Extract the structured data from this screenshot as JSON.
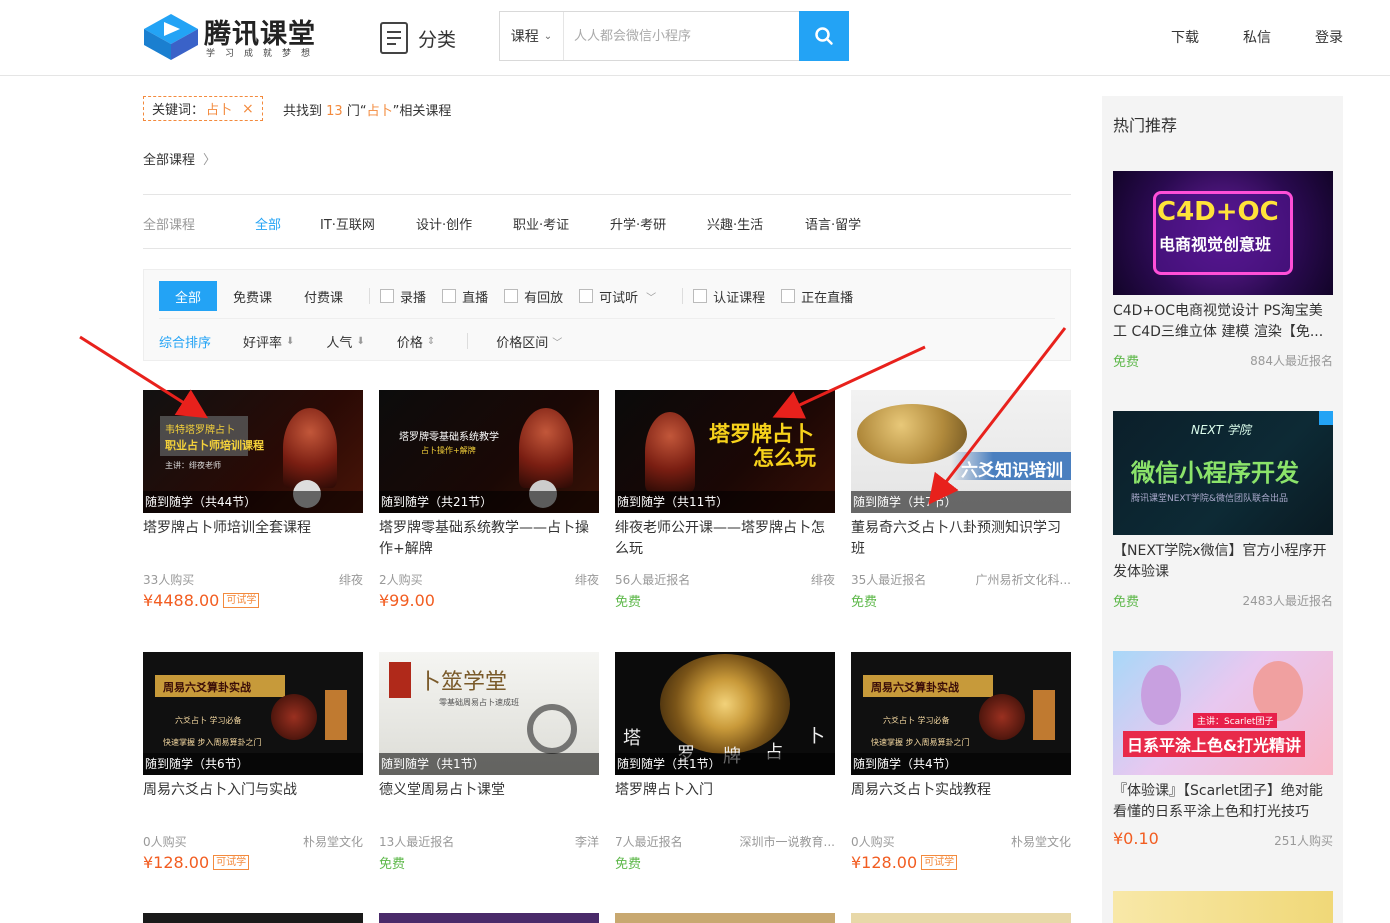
{
  "header": {
    "logo_title": "腾讯课堂",
    "logo_subtitle": "学习成就梦想",
    "category_label": "分类",
    "search_type": "课程",
    "search_placeholder": "人人都会微信小程序",
    "nav": [
      "下载",
      "私信",
      "登录"
    ]
  },
  "keyword_filter": {
    "label": "关键词：",
    "value": "占卜",
    "remove_icon": "close-icon"
  },
  "result_summary": {
    "prefix": "共找到",
    "count": "13",
    "middle": "门“",
    "keyword": "占卜",
    "suffix": "”相关课程"
  },
  "breadcrumb": "全部课程",
  "category_tabs": {
    "lead": "全部课程",
    "items": [
      "全部",
      "IT·互联网",
      "设计·创作",
      "职业·考证",
      "升学·考研",
      "兴趣·生活",
      "语言·留学"
    ],
    "active_index": 0
  },
  "filters": {
    "type_pills": [
      "全部",
      "免费课",
      "付费课"
    ],
    "checkboxes": [
      "录播",
      "直播",
      "有回放",
      "可试听",
      "认证课程",
      "正在直播"
    ],
    "sorts": [
      "综合排序",
      "好评率",
      "人气",
      "价格",
      "价格区间"
    ]
  },
  "courses": [
    {
      "badge": "随到随学（共44节）",
      "title": "塔罗牌占卜师培训全套课程",
      "buyers": "33人购买",
      "author": "绯夜",
      "price": "¥4488.00",
      "trial": "可试学",
      "thumb_text": [
        "韦特塔罗牌占卜",
        "职业占卜师培训课程",
        "主讲：绯夜老师"
      ]
    },
    {
      "badge": "随到随学（共21节）",
      "title": "塔罗牌零基础系统教学——占卜操作+解牌",
      "buyers": "2人购买",
      "author": "绯夜",
      "price": "¥99.00",
      "trial": "",
      "thumb_text": [
        "塔罗牌零基础系统教学",
        "占卜操作+解牌"
      ]
    },
    {
      "badge": "随到随学（共11节）",
      "title": "绯夜老师公开课——塔罗牌占卜怎么玩",
      "buyers": "56人最近报名",
      "author": "绯夜",
      "price": "免费",
      "trial": "",
      "thumb_text": [
        "塔罗牌占卜",
        "怎么玩"
      ]
    },
    {
      "badge": "随到随学（共7节）",
      "title": "董易奇六爻占卜八卦预测知识学习班",
      "buyers": "35人最近报名",
      "author": "广州易祈文化科...",
      "price": "免费",
      "trial": "",
      "thumb_text": [
        "六爻知识培训"
      ]
    },
    {
      "badge": "随到随学（共6节）",
      "title": "周易六爻占卜入门与实战",
      "buyers": "0人购买",
      "author": "朴易堂文化",
      "price": "¥128.00",
      "trial": "可试学",
      "thumb_text": [
        "周易六爻算卦实战",
        "六爻占卜 学习必备",
        "快速掌握 步入周易算卦之门"
      ]
    },
    {
      "badge": "随到随学（共1节）",
      "title": "德义堂周易占卜课堂",
      "buyers": "13人最近报名",
      "author": "李洋",
      "price": "免费",
      "trial": "",
      "thumb_text": [
        "卜筮学堂",
        "零基础周易占卜速成班"
      ]
    },
    {
      "badge": "随到随学（共1节）",
      "title": "塔罗牌占卜入门",
      "buyers": "7人最近报名",
      "author": "深圳市一说教育...",
      "price": "免费",
      "trial": "",
      "thumb_text": [
        "塔",
        "罗",
        "牌",
        "占",
        "卜"
      ]
    },
    {
      "badge": "随到随学（共4节）",
      "title": "周易六爻占卜实战教程",
      "buyers": "0人购买",
      "author": "朴易堂文化",
      "price": "¥128.00",
      "trial": "可试学",
      "thumb_text": [
        "周易六爻算卦实战",
        "六爻占卜 学习必备",
        "快速掌握 步入周易算卦之门"
      ]
    }
  ],
  "sidebar": {
    "title": "热门推荐",
    "items": [
      {
        "title": "C4D+OC电商视觉设计 PS淘宝美工 C4D三维立体 建模 渲染【免...",
        "price": "免费",
        "count": "884人最近报名",
        "thumb_text": [
          "C4D+OC",
          "电商视觉创意班"
        ]
      },
      {
        "title": "【NEXT学院x微信】官方小程序开发体验课",
        "price": "免费",
        "count": "2483人最近报名",
        "thumb_text": [
          "NEXT 学院",
          "微信小程序开发",
          "腾讯课堂NEXT学院&微信团队联合出品"
        ]
      },
      {
        "title": "『体验课』【Scarlet团子】绝对能看懂的日系平涂上色和打光技巧",
        "price": "¥0.10",
        "count": "251人购买",
        "thumb_text": [
          "主讲：Scarlet团子",
          "日系平涂上色&打光精讲"
        ]
      }
    ]
  },
  "colors": {
    "accent": "#23a3f5",
    "price": "#f25d21",
    "free": "#5eb84a",
    "keyword": "#f38a3d",
    "arrow": "#e8211c"
  }
}
